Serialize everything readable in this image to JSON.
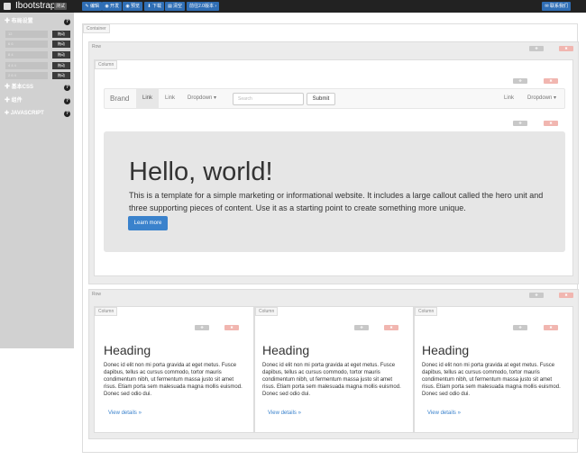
{
  "topbar": {
    "brand": "Ibootstrap",
    "badge": "测试",
    "buttons": [
      {
        "icon": "✎",
        "label": "编辑"
      },
      {
        "icon": "◉",
        "label": "开发"
      },
      {
        "icon": "◉",
        "label": "预览"
      },
      {
        "icon": "⬇",
        "label": "下载"
      },
      {
        "icon": "▤",
        "label": "清空"
      },
      {
        "label": "前往2.0版本",
        "icon": "›"
      }
    ],
    "contact": {
      "icon": "✉",
      "label": "联系我们"
    }
  },
  "sidebar": {
    "sections": [
      {
        "label": "✚ 布局设置"
      },
      {
        "label": "✚ 基本CSS"
      },
      {
        "label": "✚ 组件"
      },
      {
        "label": "✚ JAVASCRIPT"
      }
    ],
    "layout_rows": [
      {
        "value": "12",
        "drag": "拖动"
      },
      {
        "value": "6 6",
        "drag": "拖动"
      },
      {
        "value": "8 4",
        "drag": "拖动"
      },
      {
        "value": "4 4 4",
        "drag": "拖动"
      },
      {
        "value": "2 6 4",
        "drag": "拖动"
      }
    ],
    "help": "?"
  },
  "canvas": {
    "container_tag": "Container",
    "row_tag": "Row",
    "column_tag": "Column",
    "tool_icons": [
      "✥",
      "✖"
    ],
    "navbar": {
      "brand": "Brand",
      "links": [
        "Link",
        "Link"
      ],
      "dropdown": "Dropdown ▾",
      "search_placeholder": "Search",
      "submit": "Submit",
      "right_link": "Link",
      "right_dropdown": "Dropdown ▾"
    },
    "jumbotron": {
      "title": "Hello, world!",
      "text": "This is a template for a simple marketing or informational website. It includes a large callout called the hero unit and three supporting pieces of content. Use it as a starting point to create something more unique.",
      "button": "Learn more"
    },
    "columns": [
      {
        "heading": "Heading",
        "text": "Donec id elit non mi porta gravida at eget metus. Fusce dapibus, tellus ac cursus commodo, tortor mauris condimentum nibh, ut fermentum massa justo sit amet risus. Etiam porta sem malesuada magna mollis euismod. Donec sed odio dui.",
        "link": "View details »"
      },
      {
        "heading": "Heading",
        "text": "Donec id elit non mi porta gravida at eget metus. Fusce dapibus, tellus ac cursus commodo, tortor mauris condimentum nibh, ut fermentum massa justo sit amet risus. Etiam porta sem malesuada magna mollis euismod. Donec sed odio dui.",
        "link": "View details »"
      },
      {
        "heading": "Heading",
        "text": "Donec id elit non mi porta gravida at eget metus. Fusce dapibus, tellus ac cursus commodo, tortor mauris condimentum nibh, ut fermentum massa justo sit amet risus. Etiam porta sem malesuada magna mollis euismod. Donec sed odio dui.",
        "link": "View details »"
      }
    ]
  }
}
